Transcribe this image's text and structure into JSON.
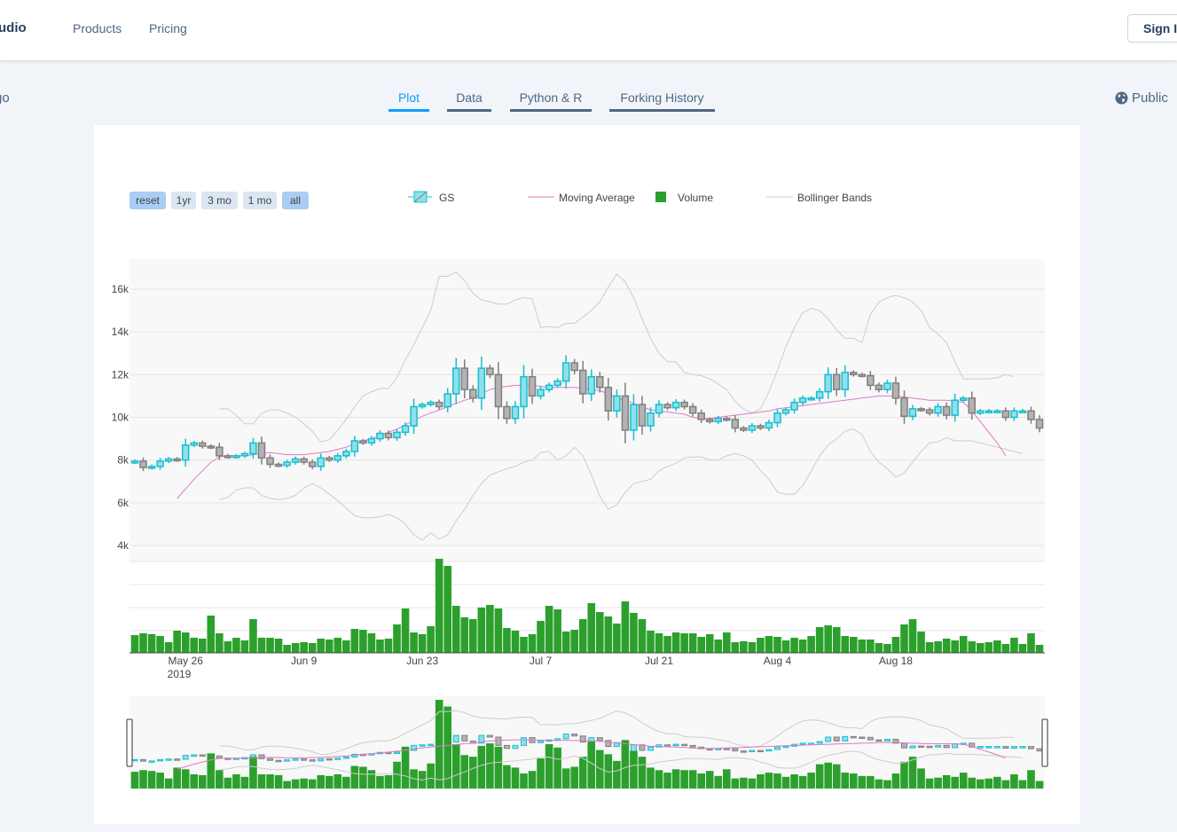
{
  "nav": {
    "brand": "udio",
    "products": "Products",
    "pricing": "Pricing",
    "sign_in": "Sign In"
  },
  "subnav": {
    "back": "go",
    "tabs": [
      "Plot",
      "Data",
      "Python & R",
      "Forking History"
    ],
    "active_tab": "Plot",
    "visibility": "Public"
  },
  "range_selector": [
    "reset",
    "1yr",
    "3 mo",
    "1 mo",
    "all"
  ],
  "range_selector_active": [
    "reset",
    "all"
  ],
  "legend": [
    "GS",
    "Moving Average",
    "Volume",
    "Bollinger Bands"
  ],
  "colors": {
    "increasing": "#17becf",
    "decreasing": "#7f7f7f",
    "volume": "#2ca02c",
    "moving_average": "#e377c2",
    "bollinger": "#cccccc",
    "accent": "#119dff"
  },
  "chart_data": {
    "type": "candlestick",
    "series_name": "GS",
    "x_start": "2019-05-20",
    "x_ticks": [
      "May 26",
      "Jun 9",
      "Jun 23",
      "Jul 7",
      "Jul 21",
      "Aug 4",
      "Aug 18"
    ],
    "x_tick_dates": [
      "2019-05-26",
      "2019-06-09",
      "2019-06-23",
      "2019-07-07",
      "2019-07-21",
      "2019-08-04",
      "2019-08-18"
    ],
    "x_year_label": "2019",
    "y_ticks": [
      "4k",
      "6k",
      "8k",
      "10k",
      "12k",
      "14k",
      "16k"
    ],
    "y_tick_values": [
      4000,
      6000,
      8000,
      10000,
      12000,
      14000,
      16000
    ],
    "ylim": [
      3500,
      17000
    ],
    "close": [
      7950,
      7650,
      7700,
      7950,
      8050,
      8000,
      8700,
      8800,
      8650,
      8600,
      8200,
      8150,
      8200,
      8300,
      8800,
      8100,
      7800,
      7750,
      7900,
      8050,
      7900,
      7700,
      8100,
      8000,
      8200,
      8400,
      8900,
      8800,
      9000,
      9250,
      9050,
      9300,
      9600,
      10500,
      10600,
      10700,
      10500,
      11100,
      12300,
      11300,
      10900,
      12300,
      12000,
      10500,
      9950,
      10500,
      11900,
      11000,
      11300,
      11500,
      11700,
      12550,
      12200,
      11100,
      11900,
      11400,
      10300,
      11000,
      9400,
      10600,
      9600,
      10200,
      10600,
      10450,
      10700,
      10500,
      10200,
      9900,
      9800,
      9950,
      9900,
      9500,
      9400,
      9600,
      9500,
      9750,
      10200,
      10350,
      10700,
      10900,
      10900,
      11200,
      12000,
      11300,
      12100,
      12000,
      11950,
      11500,
      11300,
      11600,
      10900,
      10050,
      10400,
      10350,
      10200,
      10500,
      10100,
      10800,
      10900,
      10200,
      10300,
      10300,
      10300,
      10000,
      10300,
      10300,
      9900,
      9500
    ],
    "volume": [
      20,
      22,
      21,
      19,
      12,
      25,
      23,
      17,
      16,
      42,
      22,
      13,
      17,
      14,
      38,
      17,
      17,
      16,
      9,
      11,
      12,
      11,
      16,
      15,
      17,
      14,
      27,
      26,
      22,
      15,
      16,
      32,
      50,
      23,
      21,
      30,
      106,
      98,
      53,
      40,
      38,
      51,
      54,
      50,
      28,
      25,
      18,
      21,
      36,
      53,
      49,
      24,
      26,
      38,
      56,
      46,
      41,
      33,
      58,
      45,
      38,
      25,
      22,
      19,
      23,
      22,
      22,
      18,
      21,
      15,
      23,
      12,
      13,
      12,
      17,
      19,
      18,
      14,
      17,
      15,
      19,
      29,
      31,
      29,
      19,
      18,
      15,
      15,
      11,
      10,
      18,
      32,
      38,
      24,
      12,
      13,
      16,
      14,
      19,
      13,
      11,
      12,
      14,
      10,
      17,
      10,
      22,
      9
    ],
    "moving_average": [
      null,
      null,
      null,
      null,
      null,
      6200,
      6650,
      7100,
      7500,
      7900,
      8150,
      8200,
      8200,
      8200,
      8250,
      8300,
      8350,
      8300,
      8250,
      8250,
      8250,
      8300,
      8350,
      8400,
      8500,
      8600,
      8750,
      8900,
      9000,
      9150,
      9300,
      9450,
      9650,
      9850,
      10050,
      10200,
      10350,
      10500,
      10650,
      10800,
      10900,
      11100,
      11300,
      11400,
      11450,
      11500,
      11500,
      11500,
      11450,
      11400,
      11400,
      11400,
      11400,
      11350,
      11300,
      11250,
      11100,
      10900,
      10800,
      10650,
      10500,
      10350,
      10300,
      10250,
      10200,
      10150,
      10000,
      9950,
      9950,
      10000,
      10050,
      10100,
      10150,
      10200,
      10250,
      10300,
      10400,
      10450,
      10500,
      10550,
      10600,
      10650,
      10700,
      10750,
      10800,
      10850,
      10900,
      10950,
      11000,
      11000,
      11000,
      10950,
      10900,
      10850,
      10800,
      10800,
      10800,
      10750,
      10700,
      10300,
      9800,
      9300,
      8800,
      8200
    ],
    "bollinger_upper": [
      null,
      null,
      null,
      null,
      null,
      null,
      null,
      null,
      null,
      null,
      10400,
      10400,
      10100,
      9700,
      9700,
      10200,
      10350,
      10350,
      10200,
      10000,
      9700,
      9350,
      8850,
      8950,
      9400,
      9900,
      10500,
      11000,
      11200,
      11350,
      11350,
      11850,
      12700,
      13400,
      14200,
      15000,
      16600,
      16600,
      16800,
      16400,
      15800,
      15500,
      15400,
      15300,
      15300,
      15500,
      15600,
      15550,
      14200,
      14250,
      14200,
      14400,
      14400,
      14700,
      15000,
      15400,
      16100,
      16700,
      16350,
      15600,
      14600,
      13700,
      13000,
      12600,
      12600,
      12100,
      12000,
      11950,
      11800,
      11550,
      11300,
      10750,
      10400,
      10200,
      10400,
      11200,
      12200,
      13300,
      14200,
      14900,
      15100,
      15000,
      14600,
      14100,
      13700,
      13700,
      13500,
      14800,
      15400,
      15600,
      15700,
      15600,
      15400,
      15000,
      14200,
      13900,
      13500,
      12600,
      11800,
      11800,
      11800,
      11800,
      11850,
      12000,
      11900,
      null,
      null,
      null
    ],
    "bollinger_lower": [
      null,
      null,
      null,
      null,
      null,
      null,
      null,
      null,
      null,
      null,
      6150,
      6250,
      6600,
      6700,
      6700,
      6350,
      6200,
      6150,
      6200,
      6350,
      6700,
      6900,
      6700,
      6400,
      6100,
      5750,
      5400,
      5300,
      5300,
      5350,
      5450,
      5300,
      5000,
      4500,
      4250,
      4600,
      4300,
      4500,
      5150,
      5700,
      6350,
      6900,
      7300,
      7450,
      7600,
      7700,
      7900,
      8000,
      8350,
      8400,
      8000,
      8200,
      8600,
      8200,
      7300,
      6300,
      5700,
      5900,
      6500,
      6900,
      7000,
      7100,
      7500,
      7700,
      7850,
      8100,
      8150,
      8150,
      8000,
      8000,
      8200,
      8300,
      8200,
      8000,
      7500,
      7100,
      6500,
      6400,
      6400,
      6800,
      7500,
      8200,
      8700,
      9000,
      9350,
      9450,
      9200,
      8400,
      7900,
      7600,
      7200,
      7400,
      7900,
      8400,
      8800,
      8850,
      9050,
      8900,
      8900,
      8900,
      8800,
      8700,
      8600,
      8500,
      8400,
      8300,
      null,
      null
    ]
  }
}
